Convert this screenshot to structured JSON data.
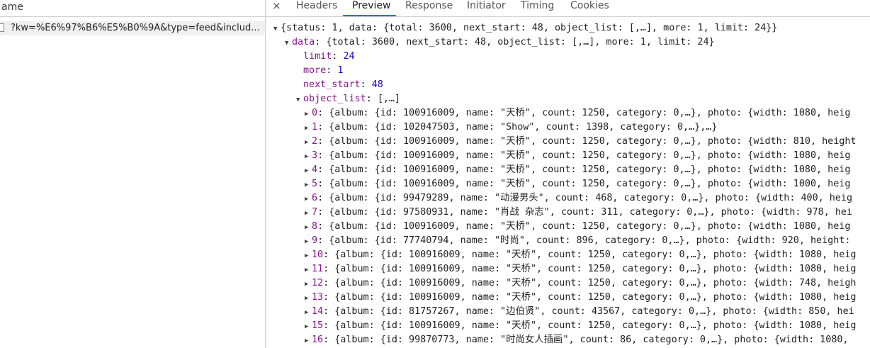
{
  "left_panel": {
    "header": "ame",
    "request_name": "?kw=%E6%97%B6%E5%B0%9A&type=feed&includ..."
  },
  "tabs": [
    {
      "label": "Headers",
      "active": false
    },
    {
      "label": "Preview",
      "active": true
    },
    {
      "label": "Response",
      "active": false
    },
    {
      "label": "Initiator",
      "active": false
    },
    {
      "label": "Timing",
      "active": false
    },
    {
      "label": "Cookies",
      "active": false
    }
  ],
  "close_glyph": "×",
  "preview": {
    "root": "{status: 1, data: {total: 3600, next_start: 48, object_list: [,…], more: 1, limit: 24}}",
    "data_key": "data",
    "data_summary": "{total: 3600, next_start: 48, object_list: [,…], more: 1, limit: 24}",
    "fields": [
      {
        "key": "limit",
        "value": "24"
      },
      {
        "key": "more",
        "value": "1"
      },
      {
        "key": "next_start",
        "value": "48"
      }
    ],
    "object_list_key": "object_list",
    "object_list_summary": "[,…]",
    "items": [
      {
        "key": "0",
        "summary": "{album: {id: 100916009, name: \"天桥\", count: 1250, category: 0,…}, photo: {width: 1080, heig"
      },
      {
        "key": "1",
        "summary": "{album: {id: 102047503, name: \"Show\", count: 1398, category: 0,…},…}"
      },
      {
        "key": "2",
        "summary": "{album: {id: 100916009, name: \"天桥\", count: 1250, category: 0,…}, photo: {width: 810, height"
      },
      {
        "key": "3",
        "summary": "{album: {id: 100916009, name: \"天桥\", count: 1250, category: 0,…}, photo: {width: 1080, heig"
      },
      {
        "key": "4",
        "summary": "{album: {id: 100916009, name: \"天桥\", count: 1250, category: 0,…}, photo: {width: 1080, heig"
      },
      {
        "key": "5",
        "summary": "{album: {id: 100916009, name: \"天桥\", count: 1250, category: 0,…}, photo: {width: 1000, heig"
      },
      {
        "key": "6",
        "summary": "{album: {id: 99479289, name: \"动漫男头\", count: 468, category: 0,…}, photo: {width: 400, heig"
      },
      {
        "key": "7",
        "summary": "{album: {id: 97580931, name: \"肖战 杂志\", count: 311, category: 0,…}, photo: {width: 978, hei"
      },
      {
        "key": "8",
        "summary": "{album: {id: 100916009, name: \"天桥\", count: 1250, category: 0,…}, photo: {width: 1080, heig"
      },
      {
        "key": "9",
        "summary": "{album: {id: 77740794, name: \"时尚\", count: 896, category: 0,…}, photo: {width: 920, height:"
      },
      {
        "key": "10",
        "summary": "{album: {id: 100916009, name: \"天桥\", count: 1250, category: 0,…}, photo: {width: 1080, heig"
      },
      {
        "key": "11",
        "summary": "{album: {id: 100916009, name: \"天桥\", count: 1250, category: 0,…}, photo: {width: 1080, heig"
      },
      {
        "key": "12",
        "summary": "{album: {id: 100916009, name: \"天桥\", count: 1250, category: 0,…}, photo: {width: 748, heigh"
      },
      {
        "key": "13",
        "summary": "{album: {id: 100916009, name: \"天桥\", count: 1250, category: 0,…}, photo: {width: 1080, heig"
      },
      {
        "key": "14",
        "summary": "{album: {id: 81757267, name: \"边伯贤\", count: 43567, category: 0,…}, photo: {width: 850, hei"
      },
      {
        "key": "15",
        "summary": "{album: {id: 100916009, name: \"天桥\", count: 1250, category: 0,…}, photo: {width: 1080, heig"
      },
      {
        "key": "16",
        "summary": "{album: {id: 99870773, name: \"时尚女人插画\", count: 86, category: 0,…}, photo: {width: 1080,"
      }
    ]
  }
}
